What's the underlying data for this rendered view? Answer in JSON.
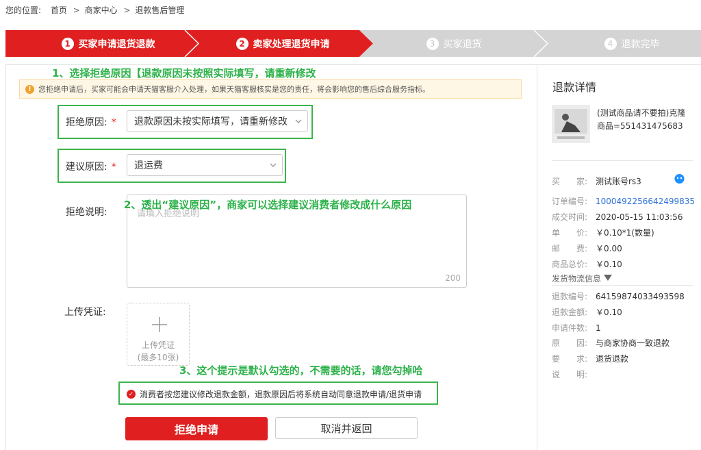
{
  "breadcrumb": {
    "prefix": "您的位置:",
    "home": "首页",
    "mid": "商家中心",
    "current": "退款售后管理",
    "sep": ">"
  },
  "steps": [
    {
      "num": "1",
      "label": "买家申请退货退款"
    },
    {
      "num": "2",
      "label": "卖家处理退货申请"
    },
    {
      "num": "3",
      "label": "买家退货"
    },
    {
      "num": "4",
      "label": "退款完毕"
    }
  ],
  "colors": {
    "accent": "#e02020",
    "annotation": "#2db24a",
    "warning_bg": "#fff7e5"
  },
  "annotations": {
    "a1": "1、选择拒绝原因【退款原因未按照实际填写，请重新修改",
    "a2": "2、透出“建议原因”，商家可以选择建议消费者修改成什么原因",
    "a3": "3、这个提示是默认勾选的，不需要的话，请您勾掉哈"
  },
  "warning": "您拒绝申请后，买家可能会申请天猫客服介入处理，如果天猫客服核实是您的责任，将会影响您的售后综合服务指标。",
  "form": {
    "reject_reason_label": "拒绝原因:",
    "reject_reason_value": "退款原因未按实际填写，请重新修改",
    "suggest_reason_label": "建议原因:",
    "suggest_reason_value": "退运费",
    "explain_label": "拒绝说明:",
    "explain_placeholder": "请填入拒绝说明",
    "explain_count": "200",
    "upload_label": "上传凭证:",
    "upload_text": "上传凭证",
    "upload_limit": "(最多10张)",
    "checkbox_text": "消费者按您建议修改退款金额，退款原因后将系统自动同意退款申请/退货申请",
    "required_mark": "*"
  },
  "buttons": {
    "reject": "拒绝申请",
    "cancel": "取消并返回"
  },
  "side": {
    "title": "退款详情",
    "product_name": "(测试商品请不要拍)克隆商品=551431475683",
    "rows1": [
      {
        "k": "买　　家:",
        "v": "测试账号rs3"
      },
      {
        "k": "订单编号:",
        "v": "1000492256642499835",
        "link": true
      },
      {
        "k": "成交时间:",
        "v": "2020-05-15 11:03:56"
      },
      {
        "k": "单　　价:",
        "v": "￥0.10*1(数量)"
      },
      {
        "k": "邮　　费:",
        "v": "￥0.00"
      },
      {
        "k": "商品总价:",
        "v": "￥0.10"
      }
    ],
    "logistics": "发货物流信息",
    "rows2": [
      {
        "k": "退款编号:",
        "v": "64159874033493598"
      },
      {
        "k": "退款金额:",
        "v": "￥0.10"
      },
      {
        "k": "申请件数:",
        "v": "1"
      },
      {
        "k": "原　　因:",
        "v": "与商家协商一致退款"
      },
      {
        "k": "要　　求:",
        "v": "退货退款"
      },
      {
        "k": "说　　明:",
        "v": ""
      }
    ]
  }
}
